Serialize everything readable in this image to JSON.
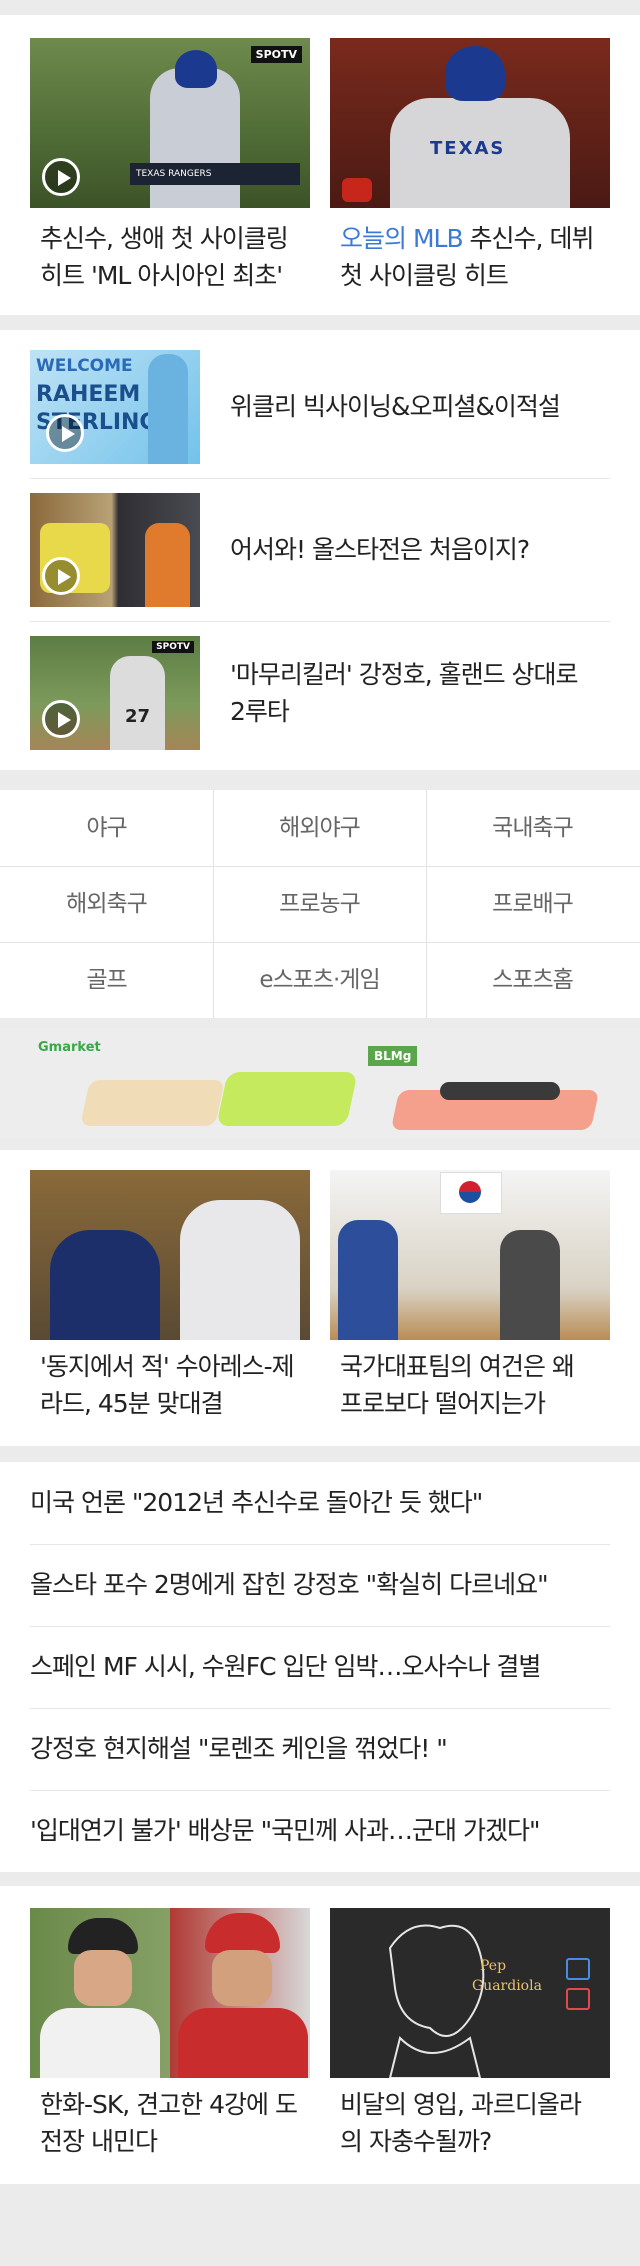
{
  "video_top": [
    {
      "prefix": "",
      "title_line1": "추신수, 생애 첫 사이클링",
      "title_line2": "히트 'ML 아시아인 최초'",
      "badge": "SPOTV",
      "overlay": "TEXAS RANGERS"
    },
    {
      "prefix": "오늘의 MLB",
      "title_line1": " 추신수, 데뷔",
      "title_line2": "첫 사이클링 히트"
    }
  ],
  "video_list": [
    {
      "title_line1": "위클리 빅사이닝&오피셜&이적설",
      "title_line2": "",
      "thumb_text1": "WELCOME",
      "thumb_text2": "RAHEEM",
      "thumb_text3": "STERLING"
    },
    {
      "title_line1": "어서와! 올스타전은 처음이지?",
      "title_line2": ""
    },
    {
      "title_line1": "'마무리킬러' 강정호, 홀랜드 상대로",
      "title_line2": "2루타",
      "badge": "SPOTV",
      "jersey": "27"
    }
  ],
  "categories": [
    "야구",
    "해외야구",
    "국내축구",
    "해외축구",
    "프로농구",
    "프로배구",
    "골프",
    "e스포츠·게임",
    "스포츠홈"
  ],
  "ad": {
    "brand": "Gmarket",
    "logo2": "BLMg",
    "accent": "#3aa845"
  },
  "photo_articles": [
    {
      "title_line1": "'동지에서 적' 수아레스-제",
      "title_line2": "라드, 45분 맞대결"
    },
    {
      "title_line1": "국가대표팀의 여건은 왜",
      "title_line2": "프로보다 떨어지는가"
    }
  ],
  "headlines": [
    "미국 언론 \"2012년 추신수로 돌아간 듯 했다\"",
    "올스타 포수 2명에게 잡힌 강정호 \"확실히 다르네요\"",
    "스페인 MF 시시, 수원FC 입단 임박…오사수나 결별",
    "강정호 현지해설 \"로렌조 케인을 꺾었다! \"",
    "'입대연기 불가' 배상문 \"국민께 사과…군대 가겠다\""
  ],
  "bottom_articles": [
    {
      "title_line1": "한화-SK, 견고한 4강에 도",
      "title_line2": "전장 내민다"
    },
    {
      "title_line1": "비달의 영입, 과르디올라",
      "title_line2": "의 자충수될까?",
      "neon1": "Pep",
      "neon2": "Guardiola"
    }
  ],
  "colors": {
    "link_blue": "#3b7bd6",
    "bg": "#ebebeb"
  }
}
